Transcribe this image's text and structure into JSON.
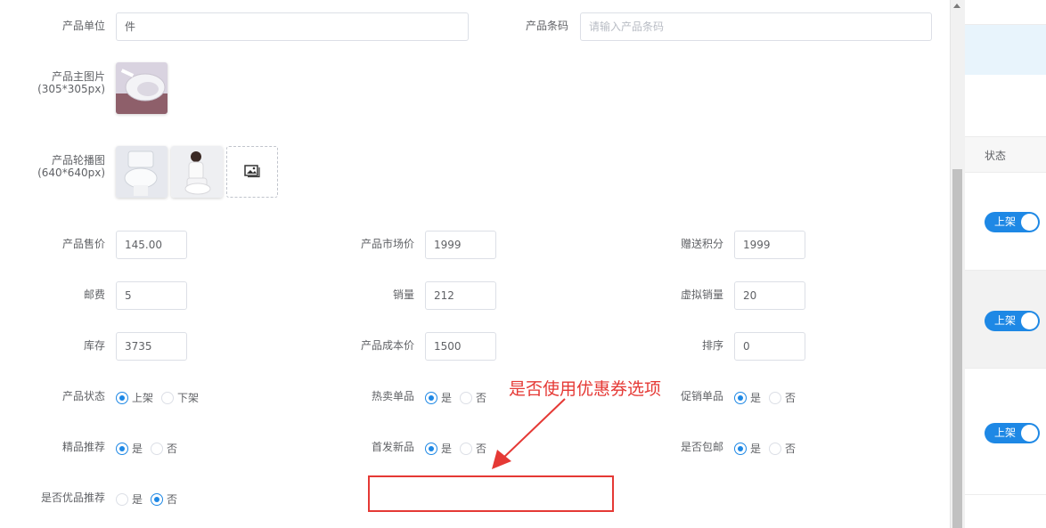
{
  "form": {
    "unit": {
      "label": "产品单位",
      "value": "件"
    },
    "barcode": {
      "label": "产品条码",
      "placeholder": "请输入产品条码"
    },
    "main_image": {
      "label": "产品主图片",
      "hint": "(305*305px)"
    },
    "carousel": {
      "label": "产品轮播图",
      "hint": "(640*640px)"
    },
    "fields": {
      "price": {
        "label": "产品售价",
        "value": "145.00"
      },
      "market_price": {
        "label": "产品市场价",
        "value": "1999"
      },
      "points": {
        "label": "赠送积分",
        "value": "1999"
      },
      "postage": {
        "label": "邮费",
        "value": "5"
      },
      "sales": {
        "label": "销量",
        "value": "212"
      },
      "virtual_sales": {
        "label": "虚拟销量",
        "value": "20"
      },
      "stock": {
        "label": "库存",
        "value": "3735"
      },
      "cost": {
        "label": "产品成本价",
        "value": "1500"
      },
      "sort": {
        "label": "排序",
        "value": "0"
      }
    },
    "radios": {
      "status": {
        "label": "产品状态",
        "options": [
          "上架",
          "下架"
        ],
        "selected": 0
      },
      "hot": {
        "label": "热卖单品",
        "options": [
          "是",
          "否"
        ],
        "selected": 0
      },
      "promo": {
        "label": "促销单品",
        "options": [
          "是",
          "否"
        ],
        "selected": 0
      },
      "featured": {
        "label": "精品推荐",
        "options": [
          "是",
          "否"
        ],
        "selected": 0
      },
      "new": {
        "label": "首发新品",
        "options": [
          "是",
          "否"
        ],
        "selected": 0
      },
      "free_ship": {
        "label": "是否包邮",
        "options": [
          "是",
          "否"
        ],
        "selected": 0
      },
      "premium": {
        "label": "是否优品推荐",
        "options": [
          "是",
          "否"
        ],
        "selected": 1
      }
    }
  },
  "annotation": {
    "text": "是否使用优惠券选项",
    "color": "#e53935"
  },
  "right_panel": {
    "header": "状态",
    "toggles": [
      "上架",
      "上架",
      "上架"
    ],
    "accent": "#1e88e5",
    "highlight_bg": "#e8f4fc"
  }
}
